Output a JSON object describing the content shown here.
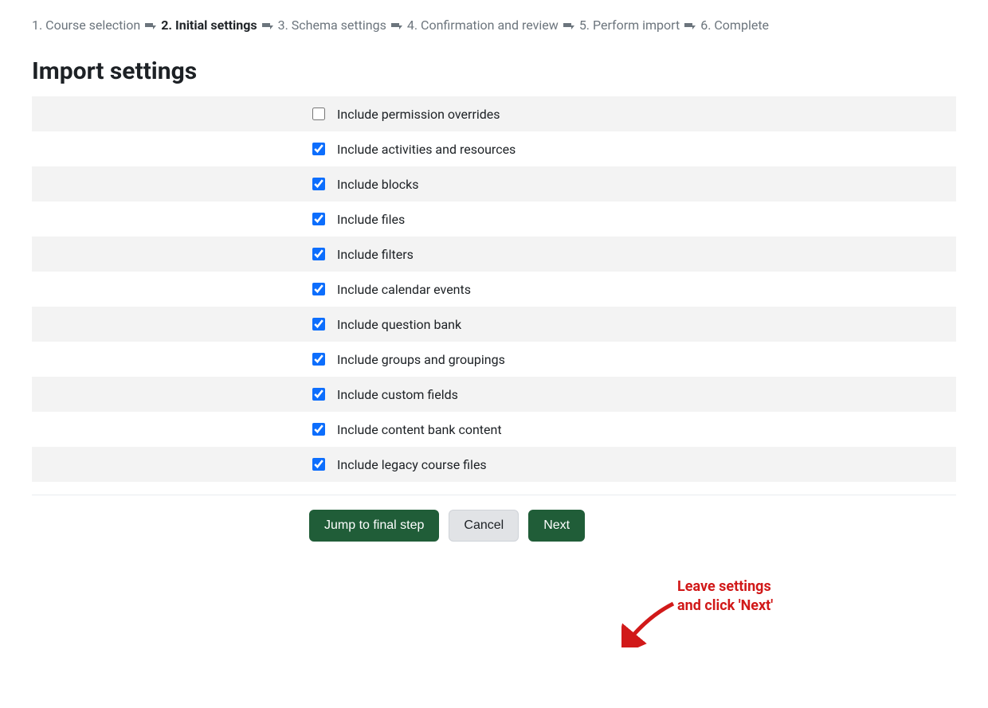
{
  "progress": {
    "steps": [
      "1. Course selection",
      "2. Initial settings",
      "3. Schema settings",
      "4. Confirmation and review",
      "5. Perform import",
      "6. Complete"
    ],
    "active_index": 1
  },
  "page_title": "Import settings",
  "settings": [
    {
      "label": "Include permission overrides",
      "checked": false
    },
    {
      "label": "Include activities and resources",
      "checked": true
    },
    {
      "label": "Include blocks",
      "checked": true
    },
    {
      "label": "Include files",
      "checked": true
    },
    {
      "label": "Include filters",
      "checked": true
    },
    {
      "label": "Include calendar events",
      "checked": true
    },
    {
      "label": "Include question bank",
      "checked": true
    },
    {
      "label": "Include groups and groupings",
      "checked": true
    },
    {
      "label": "Include custom fields",
      "checked": true
    },
    {
      "label": "Include content bank content",
      "checked": true
    },
    {
      "label": "Include legacy course files",
      "checked": true
    }
  ],
  "buttons": {
    "jump_label": "Jump to final step",
    "cancel_label": "Cancel",
    "next_label": "Next"
  },
  "annotation": {
    "line1": "Leave settings",
    "line2": "and click 'Next'",
    "color": "#d11919"
  }
}
